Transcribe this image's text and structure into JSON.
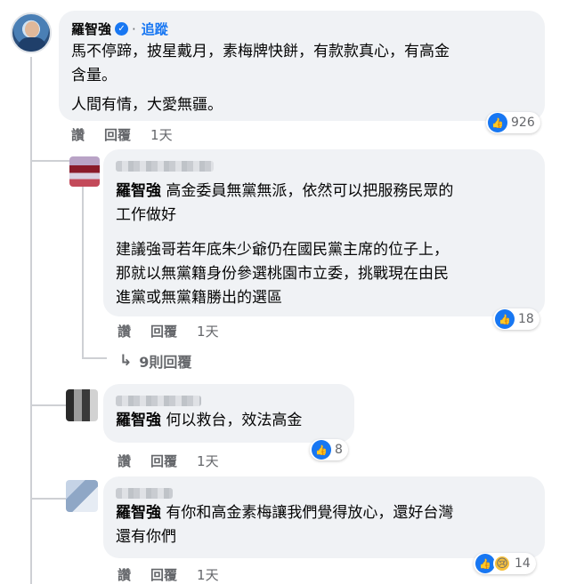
{
  "comments": [
    {
      "author": "羅智強",
      "verified_icon": "verified-badge-icon",
      "follow_label": "追蹤",
      "lines": [
        "馬不停蹄，披星戴月，素梅牌快餅，有款款真心，有高金",
        "含量。",
        "人間有情，大愛無疆。"
      ],
      "reaction_count": "926",
      "like_label": "讚",
      "reply_label": "回覆",
      "time": "1天"
    },
    {
      "author_obscured": true,
      "tag": "羅智強",
      "lines_p1": [
        " 高金委員無黨無派，依然可以把服務民眾的",
        "工作做好"
      ],
      "lines_p2": [
        "建議強哥若年底朱少爺仍在國民黨主席的位子上，",
        "那就以無黨籍身份參選桃園市立委，挑戰現在由民",
        "進黨或無黨籍勝出的選區"
      ],
      "reaction_count": "18",
      "like_label": "讚",
      "reply_label": "回覆",
      "time": "1天",
      "more_replies": "9則回覆"
    },
    {
      "author_obscured": true,
      "tag": "羅智強",
      "text": " 何以救台，效法高金",
      "reaction_count": "8",
      "like_label": "讚",
      "reply_label": "回覆",
      "time": "1天"
    },
    {
      "author_obscured": true,
      "tag": "羅智強",
      "lines": [
        " 有你和高金素梅讓我們覺得放心，還好台灣",
        "還有你們"
      ],
      "reaction_count": "14",
      "like_label": "讚",
      "reply_label": "回覆",
      "time": "1天"
    }
  ],
  "colors": {
    "accent": "#1877f2",
    "bubble": "#f0f2f5",
    "muted": "#65676b"
  }
}
